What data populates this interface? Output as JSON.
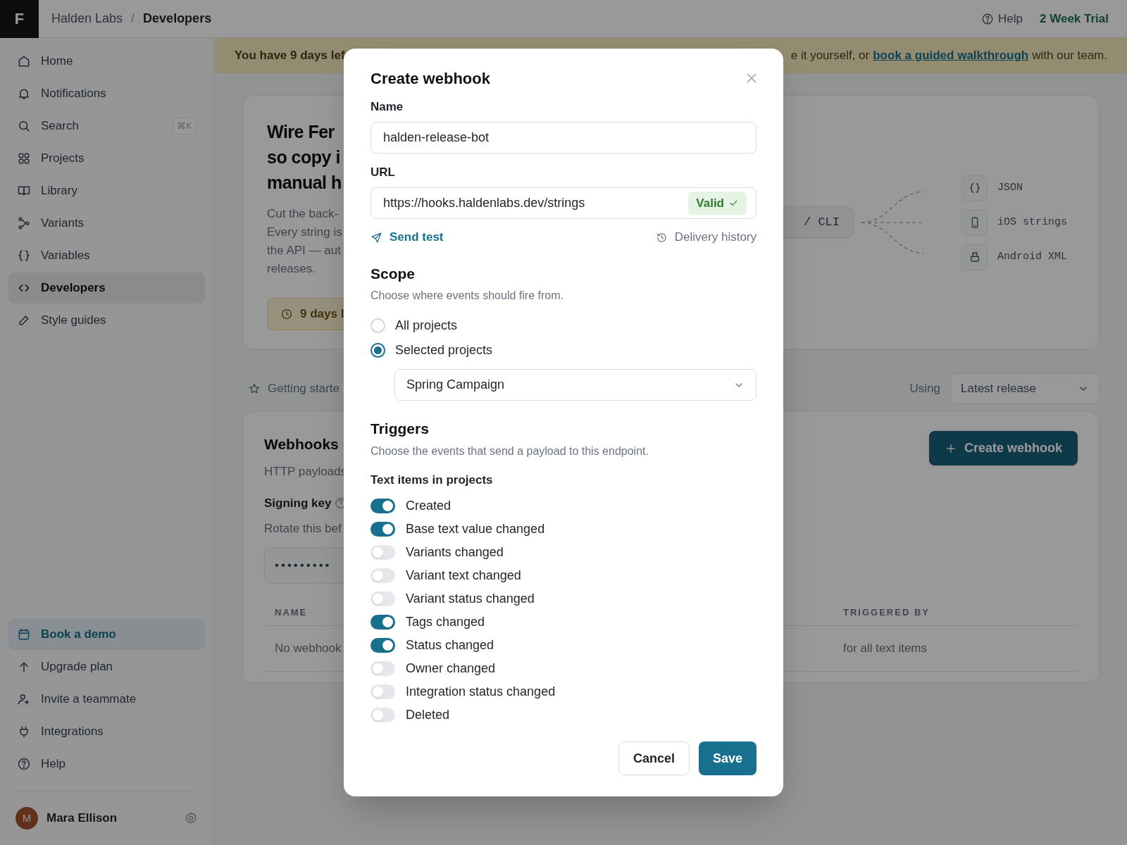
{
  "topbar": {
    "logo": "F",
    "breadcrumb": [
      "Halden Labs",
      "Developers"
    ],
    "separator": "/",
    "help": "Help",
    "trial": "2 Week Trial"
  },
  "banner": {
    "text_start": "You have 9 days lef",
    "text_end": "e it yourself, or",
    "link": "book a guided walkthrough",
    "text_tail": "with our team."
  },
  "sidebar": {
    "items": [
      {
        "label": "Home",
        "selected": false
      },
      {
        "label": "Notifications",
        "selected": false
      },
      {
        "label": "Search",
        "shortcut": "⌘K",
        "selected": false
      },
      {
        "label": "Projects",
        "selected": false
      },
      {
        "label": "Library",
        "selected": false
      },
      {
        "label": "Variants",
        "selected": false
      },
      {
        "label": "Variables",
        "selected": false
      },
      {
        "label": "Developers",
        "selected": true
      },
      {
        "label": "Style guides",
        "selected": false
      }
    ],
    "footer_items": [
      {
        "label": "Book a demo",
        "highlighted": true
      },
      {
        "label": "Upgrade plan",
        "highlighted": false
      },
      {
        "label": "Invite a teammate",
        "highlighted": false
      },
      {
        "label": "Integrations",
        "highlighted": false
      },
      {
        "label": "Help",
        "highlighted": false
      }
    ],
    "user": {
      "initial": "M",
      "name": "Mara Ellison"
    }
  },
  "hero": {
    "title_lines": [
      "Wire Fer",
      "so copy i",
      "manual h"
    ],
    "body_lines": [
      "Cut the back-",
      "Every string is",
      "the API — aut",
      "releases."
    ],
    "badge": "9 days l",
    "cli": "/ CLI",
    "outputs": [
      "JSON",
      "iOS strings",
      "Android XML"
    ]
  },
  "getting_started": {
    "label": "Getting starte",
    "using_label": "Using",
    "version_select": "Latest release"
  },
  "webhooks_card": {
    "title": "Webhooks",
    "subtitle": "HTTP payloads",
    "signing_key_label": "Signing key",
    "signing_key_hint": "Rotate this bef",
    "key_value": "•••••••••",
    "create_button": "Create webhook",
    "columns": [
      "NAME",
      "TRIGGERED BY"
    ],
    "row": [
      "No webhook",
      "for all text items"
    ]
  },
  "modal": {
    "title": "Create webhook",
    "name_label": "Name",
    "name_value": "halden-release-bot",
    "url_label": "URL",
    "url_value": "https://hooks.haldenlabs.dev/strings",
    "url_status": "Valid",
    "send_test": "Send test",
    "delivery_history": "Delivery history",
    "scope_title": "Scope",
    "scope_description": "Choose where events should fire from.",
    "scope_options": [
      {
        "label": "All projects",
        "selected": false
      },
      {
        "label": "Selected projects",
        "selected": true
      }
    ],
    "project_select": "Spring Campaign",
    "triggers_title": "Triggers",
    "triggers_description": "Choose the events that send a payload to this endpoint.",
    "group_label": "Text items in projects",
    "triggers": [
      {
        "label": "Created",
        "on": true
      },
      {
        "label": "Base text value changed",
        "on": true
      },
      {
        "label": "Variants changed",
        "on": false
      },
      {
        "label": "Variant text changed",
        "on": false
      },
      {
        "label": "Variant status changed",
        "on": false
      },
      {
        "label": "Tags changed",
        "on": true
      },
      {
        "label": "Status changed",
        "on": true
      },
      {
        "label": "Owner changed",
        "on": false
      },
      {
        "label": "Integration status changed",
        "on": false
      },
      {
        "label": "Deleted",
        "on": false
      }
    ],
    "cancel_button": "Cancel",
    "save_button": "Save"
  }
}
